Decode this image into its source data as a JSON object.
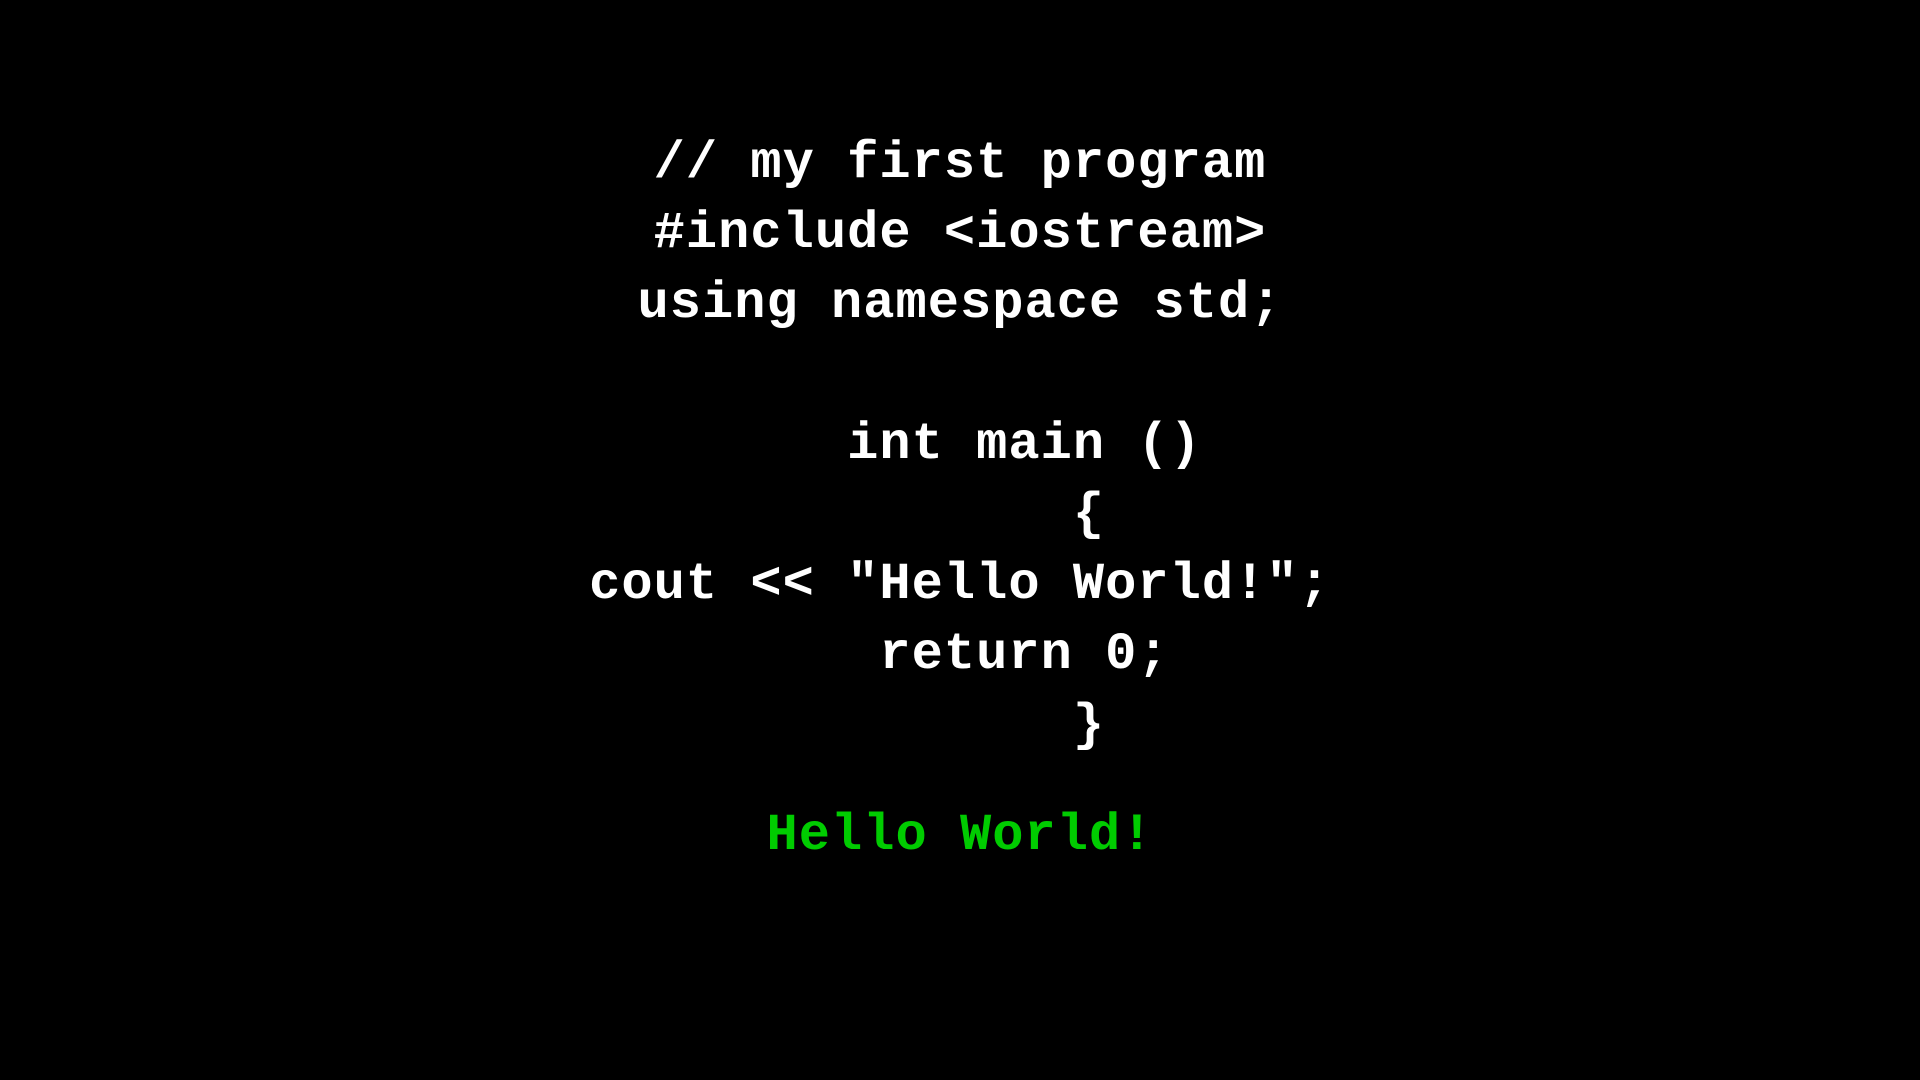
{
  "code": {
    "lines": [
      {
        "id": "comment",
        "text": "// my first program",
        "type": "code"
      },
      {
        "id": "include",
        "text": "#include <iostream>",
        "type": "code"
      },
      {
        "id": "namespace",
        "text": "using namespace std;",
        "type": "code"
      },
      {
        "id": "blank1",
        "text": "",
        "type": "code"
      },
      {
        "id": "main",
        "text": "    int main ()",
        "type": "code"
      },
      {
        "id": "open-brace",
        "text": "        {",
        "type": "code"
      },
      {
        "id": "cout",
        "text": "cout << \"Hello World!\";",
        "type": "code"
      },
      {
        "id": "return",
        "text": "    return 0;",
        "type": "code"
      },
      {
        "id": "close-brace",
        "text": "        }",
        "type": "code"
      }
    ],
    "output": "Hello World!"
  },
  "colors": {
    "background": "#000000",
    "code_text": "#ffffff",
    "output_text": "#00cc00"
  }
}
